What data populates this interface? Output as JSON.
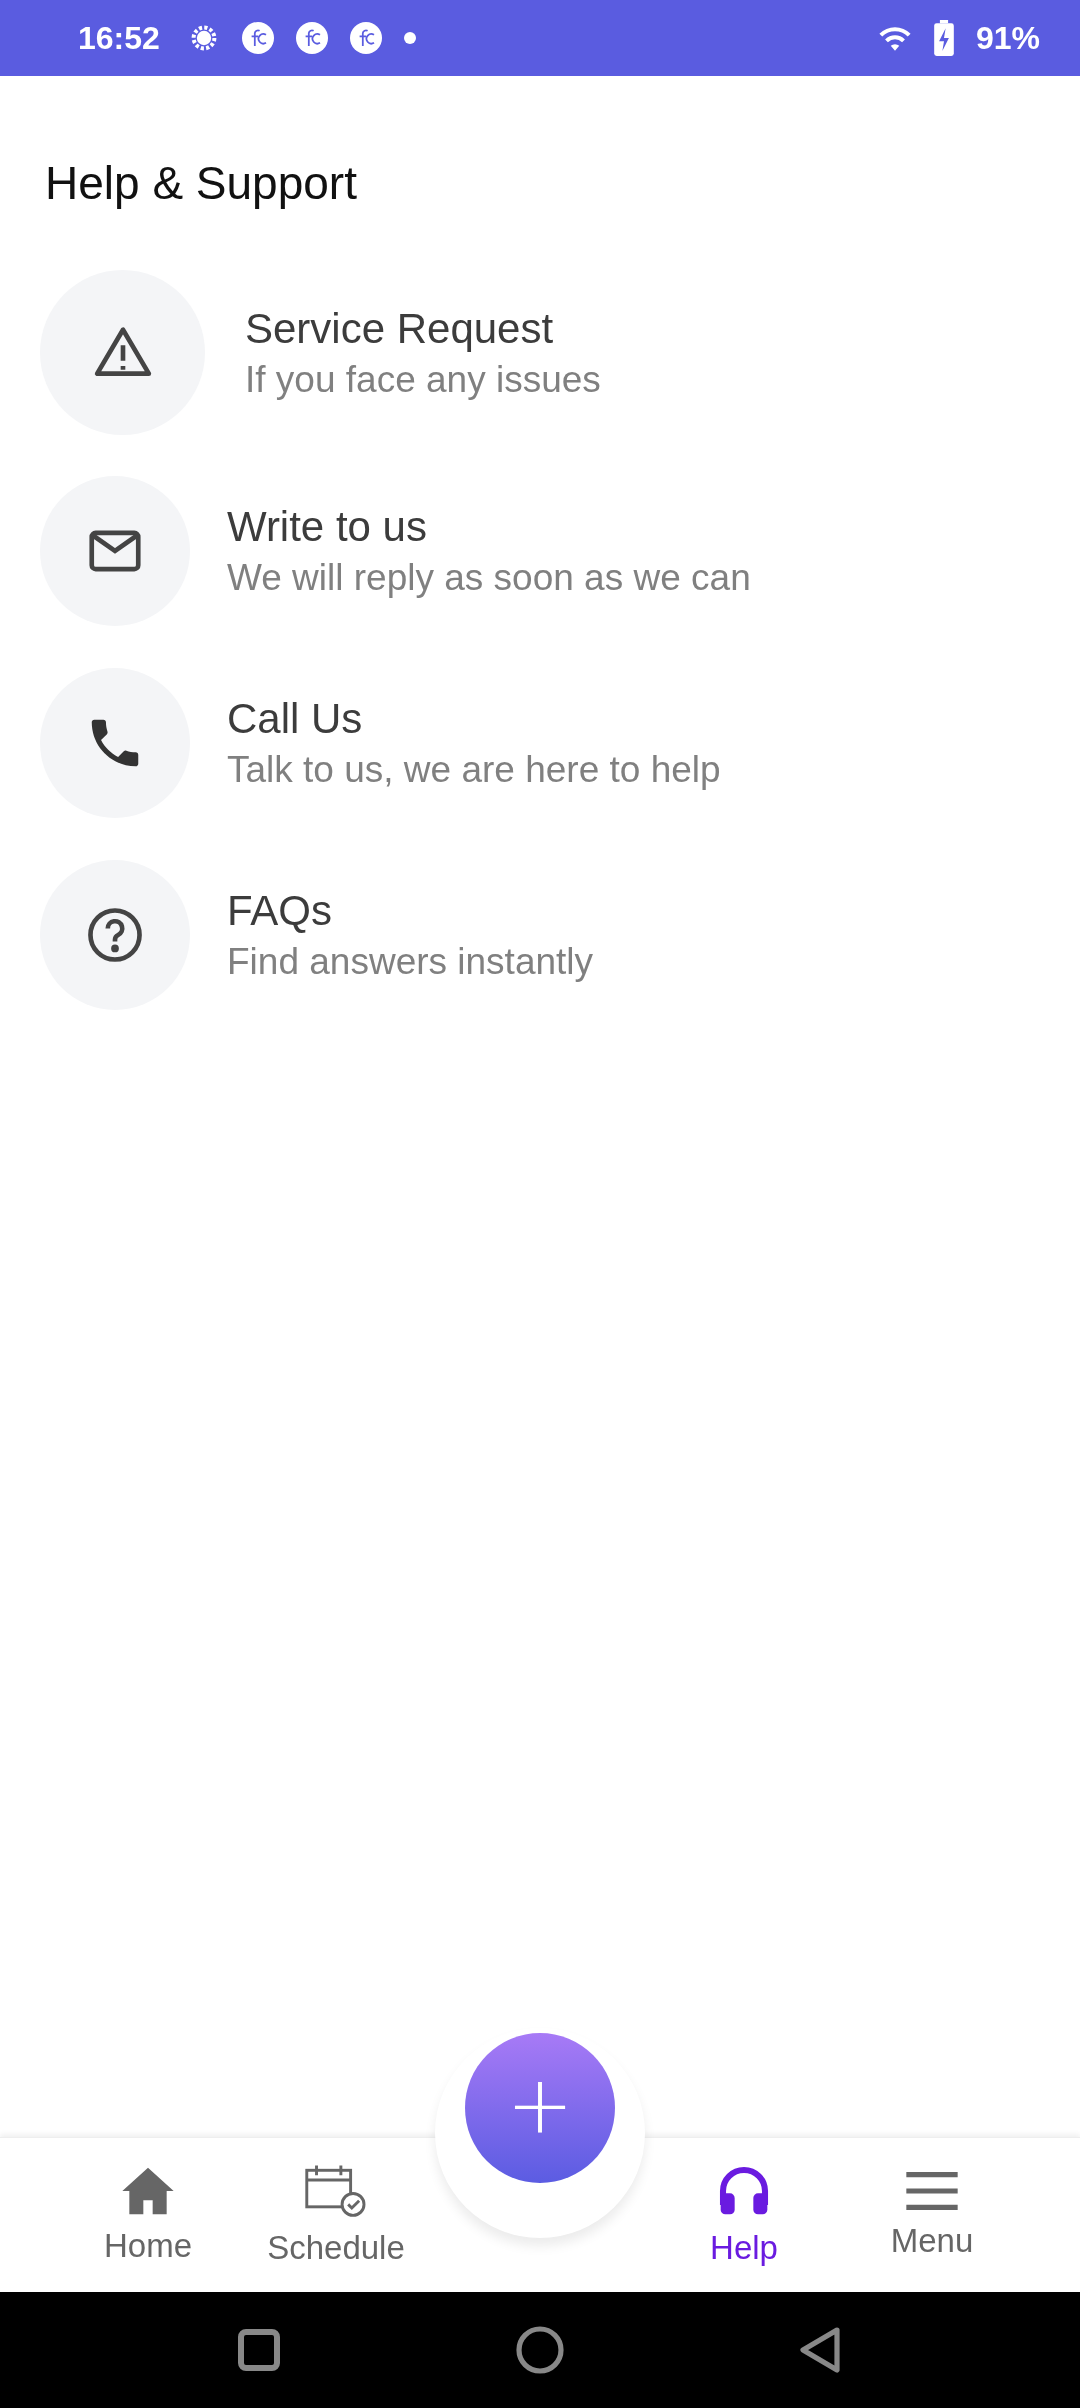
{
  "status_bar": {
    "time": "16:52",
    "battery": "91%"
  },
  "title": "Help & Support",
  "items": [
    {
      "kind": "warning",
      "title": "Service Request",
      "subtitle": "If you face any issues"
    },
    {
      "kind": "mail",
      "title": "Write to us",
      "subtitle": "We will reply as soon as we can"
    },
    {
      "kind": "phone",
      "title": "Call Us",
      "subtitle": "Talk to us, we are here to help"
    },
    {
      "kind": "faq",
      "title": "FAQs",
      "subtitle": "Find answers instantly"
    }
  ],
  "fab": {
    "label": "+"
  },
  "bottom_nav": [
    {
      "kind": "home",
      "label": "Home",
      "selected": false
    },
    {
      "kind": "schedule",
      "label": "Schedule",
      "selected": false
    },
    {
      "kind": "help",
      "label": "Help",
      "selected": true
    },
    {
      "kind": "menu",
      "label": "Menu",
      "selected": false
    }
  ]
}
